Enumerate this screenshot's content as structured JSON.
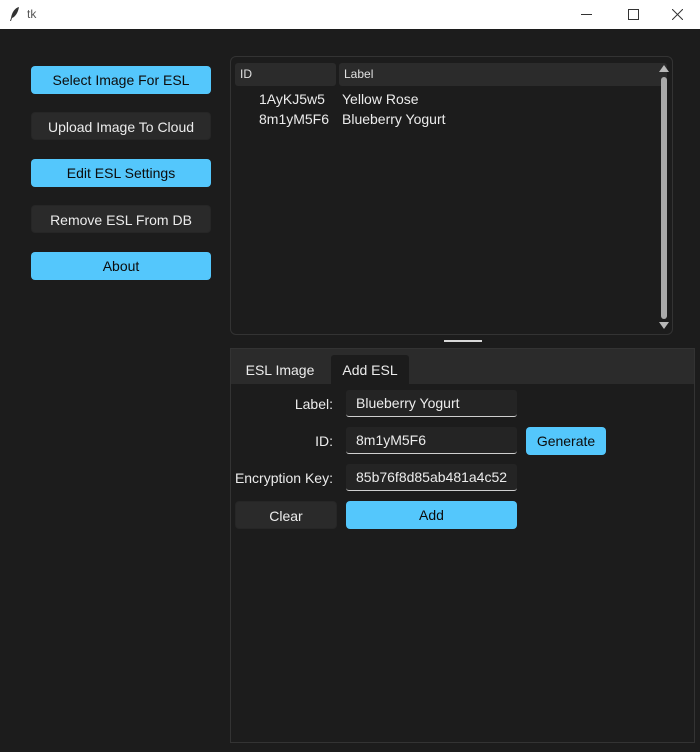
{
  "window": {
    "title": "tk"
  },
  "sidebar": {
    "select_image": "Select Image For ESL",
    "upload_image": "Upload Image To Cloud",
    "edit_settings": "Edit ESL Settings",
    "remove_esl": "Remove ESL From DB",
    "about": "About"
  },
  "table": {
    "headers": [
      "ID",
      "Label"
    ],
    "rows": [
      {
        "id": "1AyKJ5w5",
        "label": "Yellow Rose"
      },
      {
        "id": "8m1yM5F6",
        "label": "Blueberry Yogurt"
      }
    ]
  },
  "tabs": [
    "ESL Image",
    "Add ESL"
  ],
  "form": {
    "label_caption": "Label:",
    "label_value": "Blueberry Yogurt",
    "id_caption": "ID:",
    "id_value": "8m1yM5F6",
    "key_caption": "Encryption Key:",
    "key_value": "85b76f8d85ab481a4c52",
    "generate": "Generate",
    "clear": "Clear",
    "add": "Add"
  },
  "colors": {
    "accent": "#54c7fc",
    "background": "#1c1c1c",
    "button_dark": "#2a2a2a"
  }
}
